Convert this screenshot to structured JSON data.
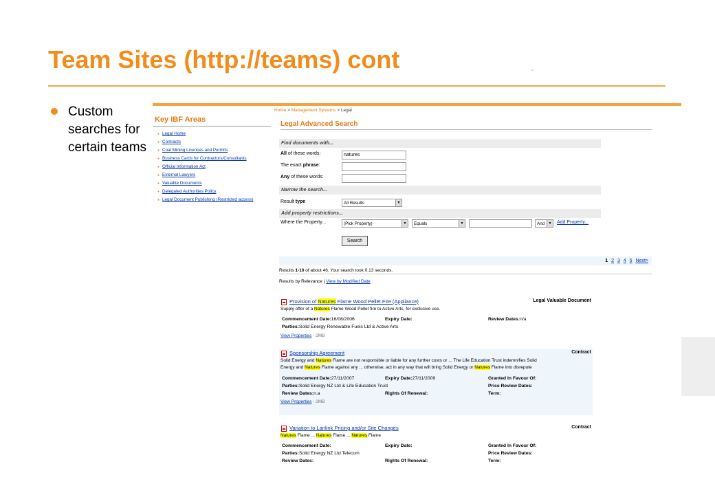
{
  "slide": {
    "title": "Team Sites (http://teams) cont",
    "bullet": "Custom searches for certain teams"
  },
  "screenshot": {
    "left_nav": {
      "title": "Key IBF Areas",
      "links": [
        "Legal Home",
        "Contracts",
        "Coal Mining Licences and Permits",
        "Business Cards for Contractors/Consultants",
        "Official Information Act",
        "External Lawyers",
        "Valuable Documents",
        "Delegated Authorities Policy",
        "Legal Document Publishing (Restricted access)"
      ]
    },
    "breadcrumb": {
      "home": "Home",
      "section": "Management Systems",
      "current": "Legal",
      "separator": ">"
    },
    "form": {
      "title": "Legal Advanced Search",
      "find_heading": "Find documents with...",
      "all_bold": "All",
      "all_rest": " of these words:",
      "all_value": "natures",
      "phrase_pre": "The exact ",
      "phrase_bold": "phrase",
      "phrase_post": ":",
      "phrase_value": "",
      "any_bold": "Any",
      "any_rest": " of these words:",
      "any_value": "",
      "narrow_heading": "Narrow the search...",
      "result_pre": "Result ",
      "result_bold": "type",
      "result_type_selected": "All Results",
      "property_heading": "Add property restrictions...",
      "where_label": "Where the Property...",
      "property_selected": "(Pick Property)",
      "operator_selected": "Equals",
      "property_value": "",
      "conjunction_selected": "And",
      "add_property_link": "Add Property...",
      "search_button": "Search"
    },
    "pager": {
      "pages": [
        "1",
        "2",
        "3",
        "4",
        "5"
      ],
      "current": "1",
      "next": "Next>"
    },
    "stats": {
      "prefix": "Results ",
      "range": "1-10",
      "suffix": " of about 46. Your search took 0.13 seconds."
    },
    "sort": {
      "by_relevance": "Results by Relevance",
      "separator": "|",
      "by_modified": "View by Modified Date"
    },
    "results": [
      {
        "title_pre": "Provision of ",
        "title_hl": "Natures",
        "title_post": " Flame Wood Pellet Fire (Appliance)",
        "type": "Legal Valuable Document",
        "s1": "Supply offer of a ",
        "s1_hl": "Natures",
        "s1_post": " Flame Wood Pellet fire to Active Arts, for exclusive use.",
        "commencement_label": "Commencement Date:",
        "commencement_value": "16/08/2006",
        "expiry_label": "Expiry Date:",
        "expiry_value": "",
        "review_label": "Review Dates:",
        "review_value": "n/a",
        "parties_label": "Parties:",
        "parties_value": "Solid Energy Renewable Fuels Ltd & Active Arts",
        "view_properties": "View Properties",
        "size": " - 2MB"
      },
      {
        "title": "Sponsorship Agreement",
        "type": "Contract",
        "s1": "Solid Energy and ",
        "s1_hl": "Natures",
        "s1_post": " Flame are not responsible or liable for any further costs or ... The Life Education Trust indemnifies Solid",
        "s2_pre": "Energy and ",
        "s2_hl": "Natures",
        "s2_mid": " Flame against any ... otherwise, act in any way that will bring Solid Energy or ",
        "s2_hl2": "Natures",
        "s2_post": " Flame into disrepute",
        "commencement_label": "Commencement Date:",
        "commencement_value": "27/11/2007",
        "expiry_label": "Expiry Date:",
        "expiry_value": "27/11/2009",
        "granted_label": "Granted In Favour Of:",
        "granted_value": "",
        "parties_label": "Parties:",
        "parties_value": "Solid Energy NZ Ltd & Life Education Trust",
        "price_label": "Price Review Dates:",
        "price_value": "",
        "review_label": "Review Dates:",
        "review_value": "n.a",
        "renewal_label": "Rights Of Renewal:",
        "renewal_value": "",
        "term_label": "Term:",
        "term_value": "",
        "view_properties": "View Properties",
        "size": " - 2MB"
      },
      {
        "title": "Variation to Lanlink Pricing and/or Site Changes",
        "type": "Contract",
        "s_hl1": "Natures",
        "s_mid1": " Flame ... ",
        "s_hl2": "Natures",
        "s_mid2": " Flame ... ",
        "s_hl3": "Natures",
        "s_post": " Flame",
        "commencement_label": "Commencement Date:",
        "commencement_value": "",
        "expiry_label": "Expiry Date:",
        "expiry_value": "",
        "granted_label": "Granted In Favour Of:",
        "granted_value": "",
        "parties_label": "Parties:",
        "parties_value": "Solid Energy NZ Ltd Telecom",
        "price_label": "Price Review Dates:",
        "price_value": "",
        "review_label": "Review Dates:",
        "review_value": "",
        "renewal_label": "Rights Of Renewal:",
        "renewal_value": "",
        "term_label": "Term:",
        "term_value": ""
      }
    ]
  }
}
